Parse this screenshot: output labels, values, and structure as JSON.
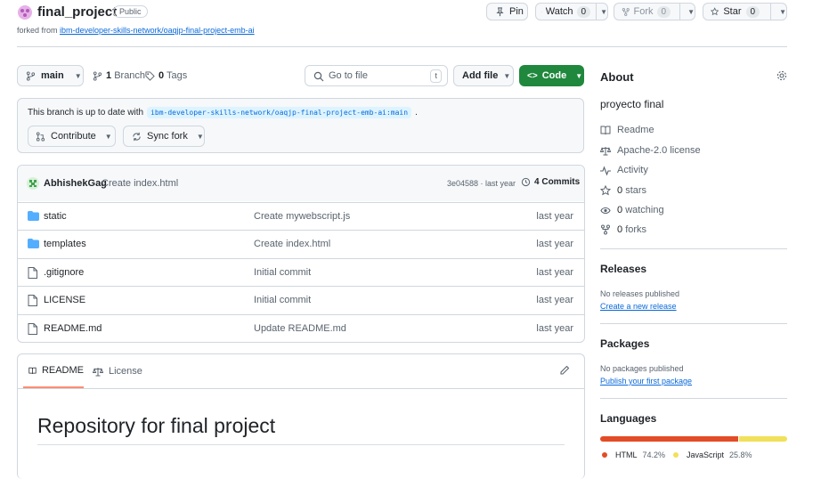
{
  "repo": {
    "name": "final_project",
    "visibility": "Public",
    "forked_label": "forked from",
    "forked_from": "ibm-developer-skills-network/oaqjp-final-project-emb-ai"
  },
  "actions": {
    "pin": "Pin",
    "watch": "Watch",
    "watch_count": "0",
    "fork": "Fork",
    "fork_count": "0",
    "star": "Star",
    "star_count": "0"
  },
  "toolbar": {
    "branch": "main",
    "branches_count": "1",
    "branches_label": "Branch",
    "tags_count": "0",
    "tags_label": "Tags",
    "search_placeholder": "Go to file",
    "search_shortcut": "t",
    "add_file": "Add file",
    "code": "Code"
  },
  "sync": {
    "text": "This branch is up to date with",
    "ref": "ibm-developer-skills-network/oaqjp-final-project-emb-ai:main",
    "period": ".",
    "contribute": "Contribute",
    "sync_fork": "Sync fork"
  },
  "commit": {
    "author": "AbhishekGag",
    "message": "Create index.html",
    "meta": "3e04588 · last year",
    "commits_count": "4",
    "commits_label": "Commits"
  },
  "files": [
    {
      "name": "static",
      "type": "folder",
      "message": "Create mywebscript.js",
      "time": "last year"
    },
    {
      "name": "templates",
      "type": "folder",
      "message": "Create index.html",
      "time": "last year"
    },
    {
      "name": ".gitignore",
      "type": "file",
      "message": "Initial commit",
      "time": "last year"
    },
    {
      "name": "LICENSE",
      "type": "file",
      "message": "Initial commit",
      "time": "last year"
    },
    {
      "name": "README.md",
      "type": "file",
      "message": "Update README.md",
      "time": "last year"
    }
  ],
  "readme": {
    "tab_readme": "README",
    "tab_license": "License",
    "heading": "Repository for final project"
  },
  "about": {
    "title": "About",
    "description": "proyecto final",
    "readme": "Readme",
    "license": "Apache-2.0 license",
    "activity": "Activity",
    "stars_count": "0",
    "stars_label": "stars",
    "watching_count": "0",
    "watching_label": "watching",
    "forks_count": "0",
    "forks_label": "forks"
  },
  "releases": {
    "title": "Releases",
    "none": "No releases published",
    "create": "Create a new release"
  },
  "packages": {
    "title": "Packages",
    "none": "No packages published",
    "publish": "Publish your first package"
  },
  "languages": {
    "title": "Languages",
    "items": [
      {
        "name": "HTML",
        "percent": "74.2%",
        "value": 74.2,
        "color": "#e34c26"
      },
      {
        "name": "JavaScript",
        "percent": "25.8%",
        "value": 25.8,
        "color": "#f1e05a"
      }
    ]
  },
  "colors": {
    "code_button": "#1f883d",
    "link": "#0969da",
    "tab_underline": "#fd8c73"
  }
}
